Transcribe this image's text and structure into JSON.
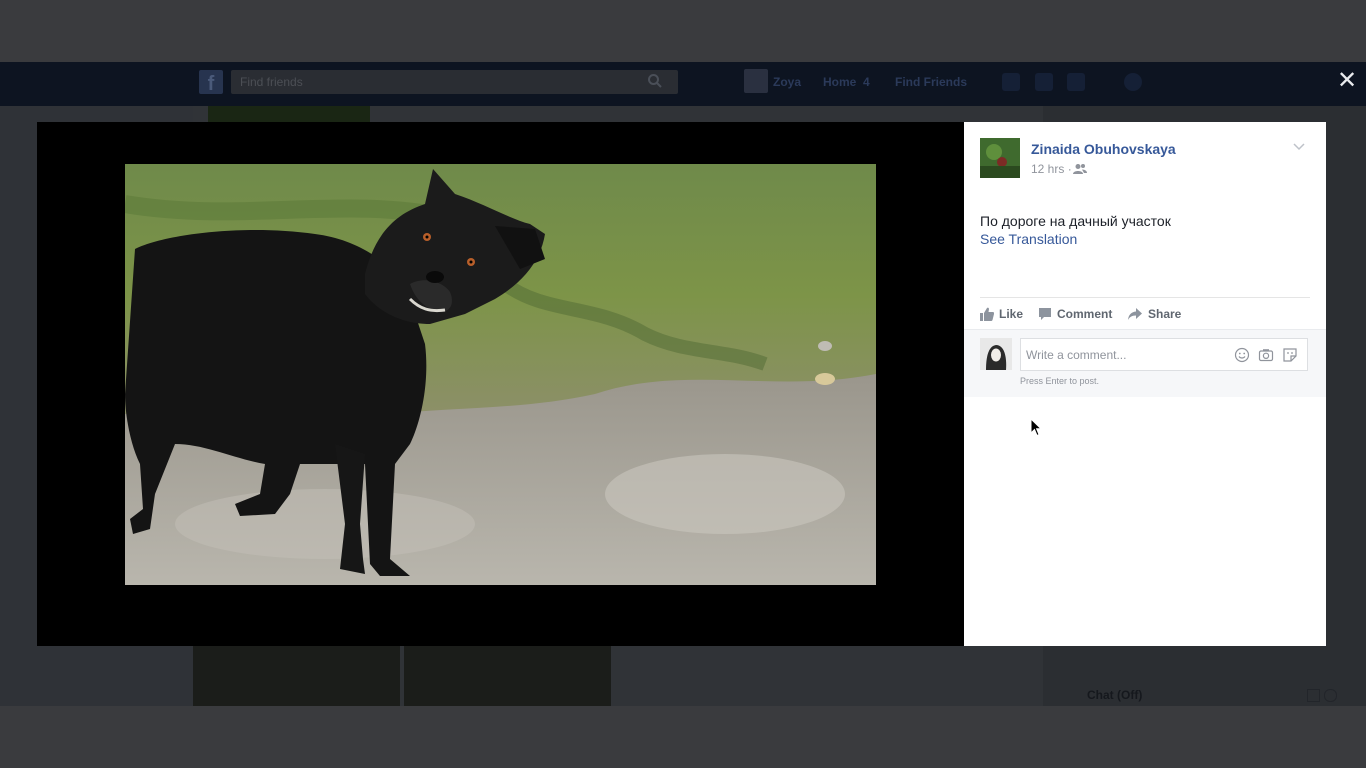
{
  "background_page": {
    "search_placeholder": "Find friends",
    "user_name": "Zoya",
    "nav_home": "Home",
    "nav_home_count": "4",
    "nav_find_friends": "Find Friends",
    "chat_label": "Chat (Off)"
  },
  "post": {
    "author": "Zinaida Obuhovskaya",
    "time": "12 hrs",
    "time_separator": "·",
    "audience_icon": "friends-icon",
    "text": "По дороге на дачный участок",
    "see_translation": "See Translation"
  },
  "actions": {
    "like": "Like",
    "comment": "Comment",
    "share": "Share"
  },
  "comment_box": {
    "placeholder": "Write a comment...",
    "hint": "Press Enter to post."
  },
  "colors": {
    "link_blue": "#365899",
    "fb_bar": "#0d1421",
    "overlay": "#3a3b3e"
  }
}
